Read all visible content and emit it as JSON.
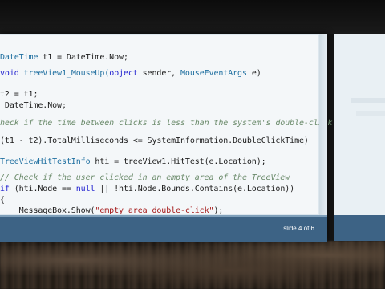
{
  "code": {
    "lines": [
      [
        {
          "t": "DateTime t1 = DateTime.Now;",
          "c": "ty-first"
        }
      ],
      [
        {
          "t": "void ",
          "c": "kw"
        },
        {
          "t": "treeView1_MouseUp(",
          "c": "ty"
        },
        {
          "t": "object ",
          "c": "kw"
        },
        {
          "t": "sender, ",
          "c": ""
        },
        {
          "t": "MouseEventArgs ",
          "c": "ty"
        },
        {
          "t": "e)",
          "c": ""
        }
      ],
      [],
      [
        {
          "t": "t2 = t1;",
          "c": ""
        }
      ],
      [
        {
          "t": " DateTime.Now;",
          "c": ""
        }
      ],
      [
        {
          "t": "heck if the time between clicks is less than the system's double-click",
          "c": "cm"
        }
      ],
      [],
      [
        {
          "t": "(t1 - t2).TotalMilliseconds <= SystemInformation.DoubleClickTime)",
          "c": ""
        }
      ],
      [],
      [
        {
          "t": "TreeViewHitTestInfo ",
          "c": "ty"
        },
        {
          "t": "hti = treeView1.HitTest(e.Location);",
          "c": ""
        }
      ],
      [
        {
          "t": "// Check if the user clicked in an empty area of the TreeView",
          "c": "cm"
        }
      ],
      [
        {
          "t": "if ",
          "c": "kw"
        },
        {
          "t": "(hti.Node == ",
          "c": ""
        },
        {
          "t": "null ",
          "c": "kw"
        },
        {
          "t": "|| !hti.Node.Bounds.Contains(e.Location))",
          "c": ""
        }
      ],
      [
        {
          "t": "{",
          "c": ""
        }
      ],
      [
        {
          "t": "    MessageBox.Show(",
          "c": ""
        },
        {
          "t": "\"empty area double-click\"",
          "c": "st"
        },
        {
          "t": ");",
          "c": ""
        }
      ]
    ]
  },
  "slide_number": "slide 4 of 6"
}
